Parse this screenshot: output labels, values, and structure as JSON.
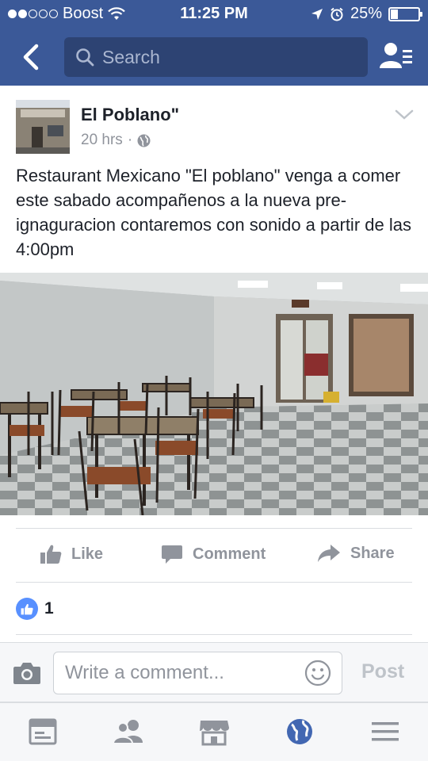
{
  "status_bar": {
    "carrier": "Boost",
    "time": "11:25 PM",
    "battery": "25%",
    "battery_level": 0.25
  },
  "header": {
    "search_placeholder": "Search",
    "icons": {
      "back": "back-arrow-icon",
      "search": "search-icon",
      "profile": "friend-list-icon"
    }
  },
  "post": {
    "page_name": "El Poblano\"",
    "time": "20 hrs",
    "audience_icon": "globe-icon",
    "text": "Restaurant Mexicano \"El poblano\"  venga a comer este sabado acompañenos a la nueva pre-ignaguracion contaremos con sonido a partir de las 4:00pm",
    "actions": {
      "like": "Like",
      "comment": "Comment",
      "share": "Share"
    },
    "like_count": "1"
  },
  "comment_bar": {
    "placeholder": "Write a comment...",
    "post_label": "Post"
  },
  "tab_bar": {
    "tabs": [
      "news-feed-icon",
      "friends-icon",
      "marketplace-icon",
      "notifications-globe-icon",
      "menu-icon"
    ],
    "active": "notifications-globe-icon"
  },
  "colors": {
    "brand": "#3b5998",
    "search_bg": "#2d4373",
    "accent": "#5890ff",
    "muted": "#90949c"
  }
}
